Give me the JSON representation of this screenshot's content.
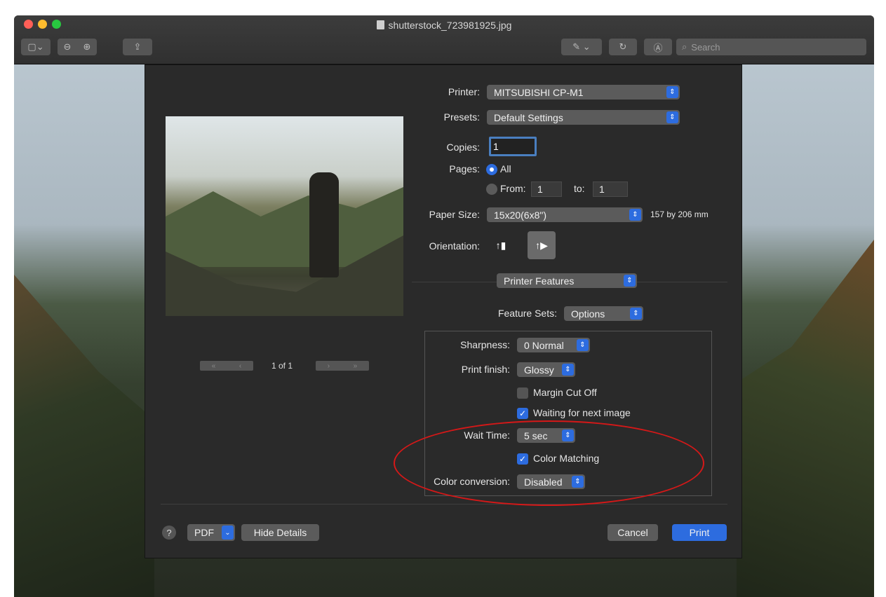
{
  "window": {
    "title": "shutterstock_723981925.jpg"
  },
  "toolbar": {
    "search_placeholder": "Search"
  },
  "preview": {
    "page_text": "1 of 1"
  },
  "printer": {
    "label": "Printer:",
    "value": "MITSUBISHI CP-M1"
  },
  "presets": {
    "label": "Presets:",
    "value": "Default Settings"
  },
  "copies": {
    "label": "Copies:",
    "value": "1"
  },
  "pages": {
    "label": "Pages:",
    "all_label": "All",
    "from_label": "From:",
    "from_value": "1",
    "to_label": "to:",
    "to_value": "1"
  },
  "paper": {
    "label": "Paper Size:",
    "value": "15x20(6x8\")",
    "dimensions": "157 by 206 mm"
  },
  "orientation": {
    "label": "Orientation:"
  },
  "section": {
    "value": "Printer Features"
  },
  "feature_sets": {
    "label": "Feature Sets:",
    "value": "Options"
  },
  "sharpness": {
    "label": "Sharpness:",
    "value": "0 Normal"
  },
  "print_finish": {
    "label": "Print finish:",
    "value": "Glossy"
  },
  "margin_cut": {
    "label": "Margin Cut Off",
    "checked": false
  },
  "waiting": {
    "label": "Waiting for next image",
    "checked": true
  },
  "wait_time": {
    "label": "Wait Time:",
    "value": "5 sec"
  },
  "color_matching": {
    "label": "Color Matching",
    "checked": true
  },
  "color_conversion": {
    "label": "Color conversion:",
    "value": "Disabled"
  },
  "footer": {
    "help": "?",
    "pdf": "PDF",
    "hide_details": "Hide Details",
    "cancel": "Cancel",
    "print": "Print"
  },
  "colors": {
    "accent": "#2d6cdf",
    "annotation": "#d51818"
  }
}
